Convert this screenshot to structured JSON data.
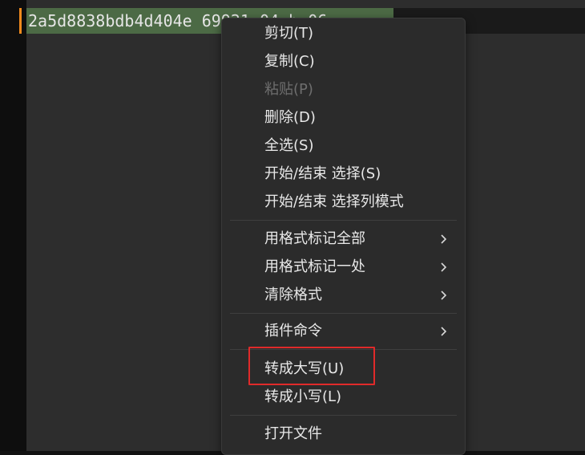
{
  "editor": {
    "selected_text": "2a5d8838bdb4d404e 69921 04 b 06"
  },
  "context_menu": {
    "items": [
      {
        "label": "剪切(T)",
        "enabled": true
      },
      {
        "label": "复制(C)",
        "enabled": true
      },
      {
        "label": "粘贴(P)",
        "enabled": false
      },
      {
        "label": "删除(D)",
        "enabled": true
      },
      {
        "label": "全选(S)",
        "enabled": true
      },
      {
        "label": "开始/结束 选择(S)",
        "enabled": true
      },
      {
        "label": "开始/结束 选择列模式",
        "enabled": true
      },
      {
        "label": "用格式标记全部",
        "enabled": true,
        "submenu": true
      },
      {
        "label": "用格式标记一处",
        "enabled": true,
        "submenu": true
      },
      {
        "label": "清除格式",
        "enabled": true,
        "submenu": true
      },
      {
        "label": "插件命令",
        "enabled": true,
        "submenu": true
      },
      {
        "label": "转成大写(U)",
        "enabled": true,
        "highlighted": true
      },
      {
        "label": "转成小写(L)",
        "enabled": true
      },
      {
        "label": "打开文件",
        "enabled": true
      }
    ]
  },
  "colors": {
    "highlight_box": "#e02a2a",
    "selection": "#4c6a45",
    "caret_marker": "#f08a1d"
  }
}
